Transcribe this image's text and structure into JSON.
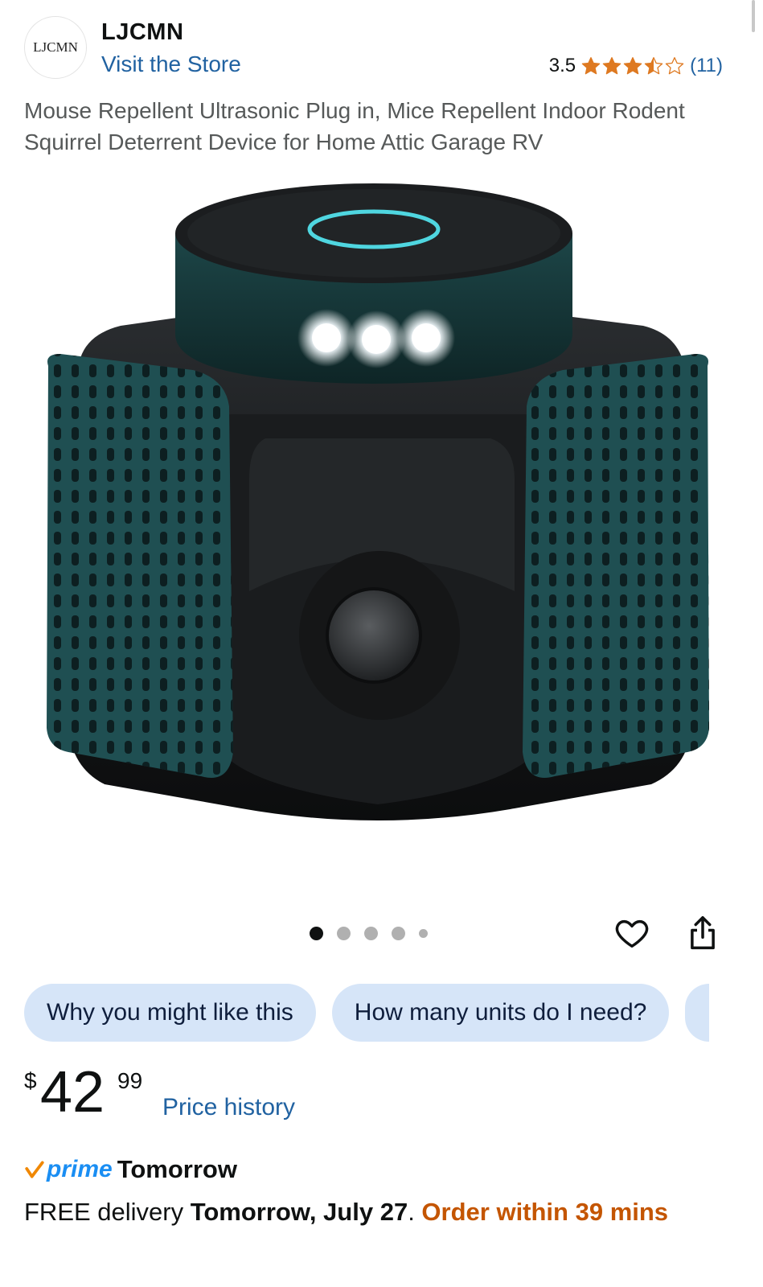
{
  "store": {
    "logo_text": "LJCMN",
    "brand_name": "LJCMN",
    "visit_store_label": "Visit the Store"
  },
  "rating": {
    "value": "3.5",
    "stars": 3.5,
    "max_stars": 5,
    "count_label": "(11)"
  },
  "product": {
    "title": "Mouse Repellent Ultrasonic Plug in, Mice Repellent Indoor Rodent Squirrel Deterrent Device for Home Attic Garage RV"
  },
  "carousel": {
    "total_images": 5,
    "active_index": 0
  },
  "actions": {
    "heart_icon": "heart-outline-icon",
    "share_icon": "share-icon"
  },
  "chips": [
    {
      "label": "Why you might like this"
    },
    {
      "label": "How many units do I need?"
    }
  ],
  "price": {
    "symbol": "$",
    "whole": "42",
    "fraction": "99",
    "history_label": "Price history"
  },
  "prime": {
    "word": "prime",
    "day": "Tomorrow"
  },
  "delivery": {
    "prefix": "FREE delivery ",
    "date": "Tomorrow, July 27",
    "separator": ". ",
    "cutoff": "Order within 39 mins"
  },
  "colors": {
    "link": "#2162a1",
    "star": "#de7921",
    "chip_bg": "#d6e5f8",
    "prime": "#1a8ef3",
    "order_within": "#c45500",
    "device_teal": "#1f4f52"
  }
}
